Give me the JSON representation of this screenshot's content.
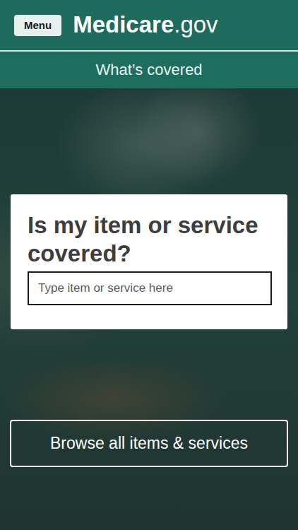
{
  "header": {
    "menu_button": "Menu",
    "logo": {
      "brand": "Medicare",
      "suffix": ".gov"
    }
  },
  "nav": {
    "title": "What’s covered"
  },
  "search_card": {
    "title": "Is my item or service covered?",
    "placeholder": "Type item or service here"
  },
  "browse_button": "Browse all items & services"
}
